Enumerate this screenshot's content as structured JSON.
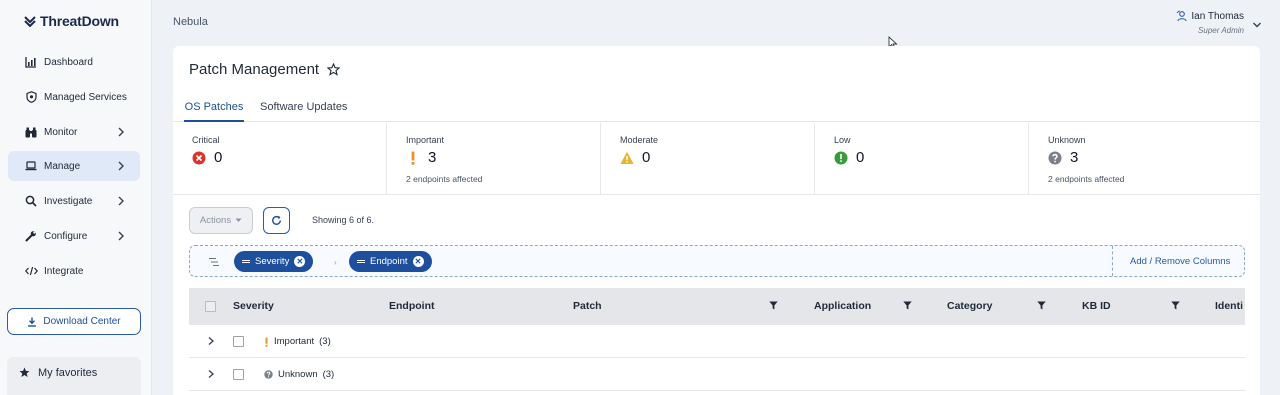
{
  "app": {
    "brand": "ThreatDown",
    "context": "Nebula"
  },
  "sidebar": {
    "items": [
      {
        "label": "Dashboard",
        "icon": "chart-icon"
      },
      {
        "label": "Managed Services",
        "icon": "shield-icon"
      },
      {
        "label": "Monitor",
        "icon": "binoculars-icon"
      },
      {
        "label": "Manage",
        "icon": "laptop-icon"
      },
      {
        "label": "Investigate",
        "icon": "search-icon"
      },
      {
        "label": "Configure",
        "icon": "wrench-icon"
      },
      {
        "label": "Integrate",
        "icon": "code-icon"
      }
    ],
    "download_label": "Download Center",
    "favorites_label": "My favorites"
  },
  "user": {
    "name": "Ian Thomas",
    "role": "Super Admin"
  },
  "page": {
    "title": "Patch Management"
  },
  "tabs": [
    {
      "label": "OS Patches"
    },
    {
      "label": "Software Updates"
    }
  ],
  "severity_summary": [
    {
      "label": "Critical",
      "value": "0",
      "sub": "",
      "icon": "x-circle-icon",
      "color": "#d9342b"
    },
    {
      "label": "Important",
      "value": "3",
      "sub": "2 endpoints affected",
      "icon": "exclamation-icon",
      "color": "#e8912d"
    },
    {
      "label": "Moderate",
      "value": "0",
      "sub": "",
      "icon": "warning-triangle-icon",
      "color": "#e8b52d"
    },
    {
      "label": "Low",
      "value": "0",
      "sub": "",
      "icon": "exclamation-circle-icon",
      "color": "#3a9b3d"
    },
    {
      "label": "Unknown",
      "value": "3",
      "sub": "2 endpoints affected",
      "icon": "question-circle-icon",
      "color": "#7b8088"
    }
  ],
  "toolbar": {
    "actions_label": "Actions",
    "showing": "Showing 6 of 6."
  },
  "grouping": {
    "chips": [
      {
        "label": "Severity"
      },
      {
        "label": "Endpoint"
      }
    ],
    "add_remove_label": "Add / Remove Columns"
  },
  "table": {
    "columns": [
      "Severity",
      "Endpoint",
      "Patch",
      "Application",
      "Category",
      "KB ID",
      "Identi"
    ],
    "rows": [
      {
        "label": "Important",
        "count": "(3)"
      },
      {
        "label": "Unknown",
        "count": "(3)"
      }
    ]
  },
  "colors": {
    "accent": "#1d4f9c",
    "active_nav": "#e0e9f7"
  }
}
